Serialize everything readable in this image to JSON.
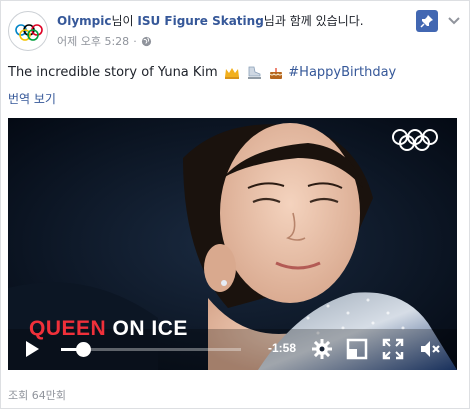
{
  "header": {
    "page_name": "Olympic",
    "connector_text": "님이 ",
    "tagged_page": "ISU Figure Skating",
    "trailing_text": "님과 함께 있습니다.",
    "timestamp": "어제 오후 5:28",
    "privacy_icon": "globe-icon",
    "pin_icon": "pin-icon",
    "menu_icon": "chevron-down-icon"
  },
  "post": {
    "text": "The incredible story of Yuna Kim",
    "emojis": [
      "crown-icon",
      "ice-skate-icon",
      "cake-icon"
    ],
    "hashtag": "#HappyBirthday",
    "translate_label": "번역 보기"
  },
  "video": {
    "caption_red": "QUEEN",
    "caption_white": " ON ICE",
    "time_remaining": "-1:58",
    "progress": 0.12,
    "icons": [
      "play-icon",
      "settings-gear-icon",
      "pip-icon",
      "fullscreen-icon",
      "mute-icon"
    ]
  },
  "footer": {
    "views": "조회 64만회"
  },
  "colors": {
    "link": "#365899",
    "brand": "#4267b2",
    "caption_red": "#f0303a",
    "meta_gray": "#90949c"
  }
}
